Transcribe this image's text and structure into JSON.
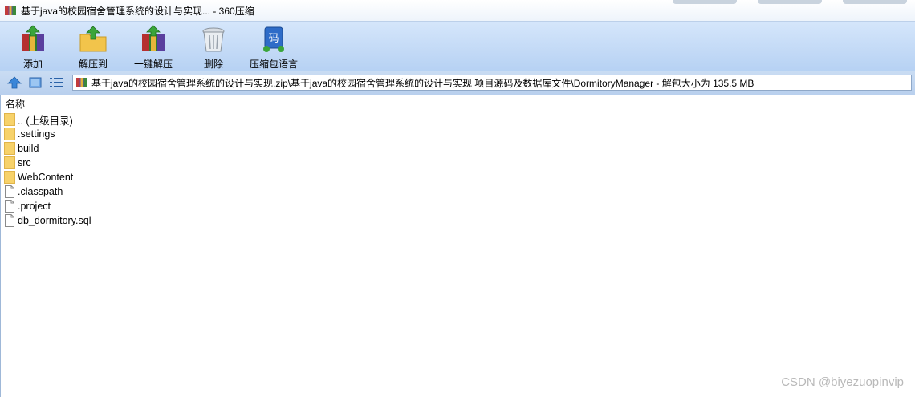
{
  "window": {
    "title": "基于java的校园宿舍管理系统的设计与实现... - 360压缩"
  },
  "toolbar": {
    "add_label": "添加",
    "extract_to_label": "解压到",
    "one_click_extract_label": "一键解压",
    "delete_label": "删除",
    "archive_language_label": "压缩包语言"
  },
  "address": {
    "path": "基于java的校园宿舍管理系统的设计与实现.zip\\基于java的校园宿舍管理系统的设计与实现 项目源码及数据库文件\\DormitoryManager - 解包大小为 135.5 MB"
  },
  "filelist": {
    "column_name": "名称",
    "items": [
      {
        "name": ".. (上级目录)",
        "icon": "folder-icon"
      },
      {
        "name": ".settings",
        "icon": "folder-icon"
      },
      {
        "name": "build",
        "icon": "folder-icon"
      },
      {
        "name": "src",
        "icon": "folder-icon"
      },
      {
        "name": "WebContent",
        "icon": "folder-icon"
      },
      {
        "name": ".classpath",
        "icon": "file-icon"
      },
      {
        "name": ".project",
        "icon": "file-icon"
      },
      {
        "name": "db_dormitory.sql",
        "icon": "file-icon"
      }
    ]
  },
  "watermark": "CSDN @biyezuopinvip",
  "colors": {
    "toolbar_bg": "#c4dbf6",
    "folder": "#f7d26a",
    "accent": "#3a7bd5"
  }
}
